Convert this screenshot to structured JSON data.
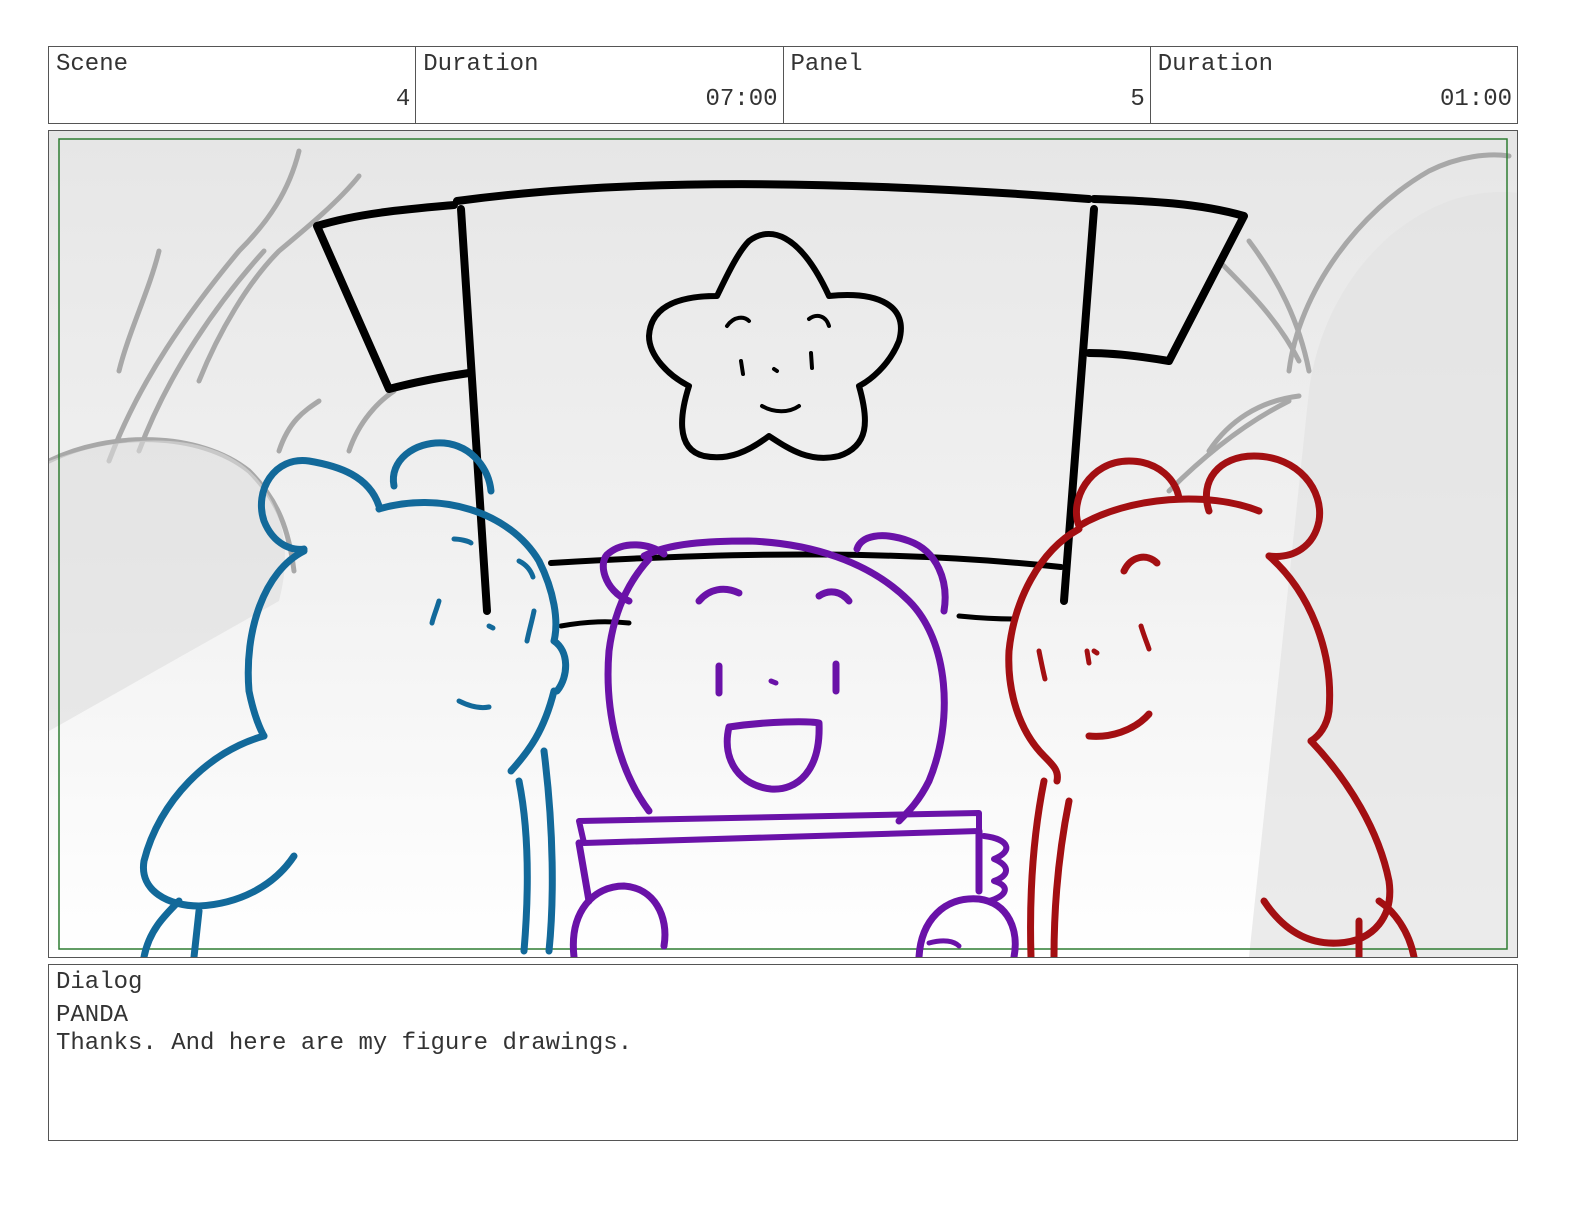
{
  "header": {
    "scene_label": "Scene",
    "scene_value": "4",
    "scene_duration_label": "Duration",
    "scene_duration_value": "07:00",
    "panel_label": "Panel",
    "panel_value": "5",
    "panel_duration_label": "Duration",
    "panel_duration_value": "01:00"
  },
  "artwork": {
    "colors": {
      "blue_bear": "#12699a",
      "purple_bear": "#6a12a8",
      "red_bear": "#a30f12",
      "sign": "#000000",
      "background_sketch": "#a8a8a8",
      "safe_area": "#2e7d32"
    }
  },
  "dialog": {
    "label": "Dialog",
    "speaker": "PANDA",
    "line": "Thanks. And here are my figure drawings."
  }
}
